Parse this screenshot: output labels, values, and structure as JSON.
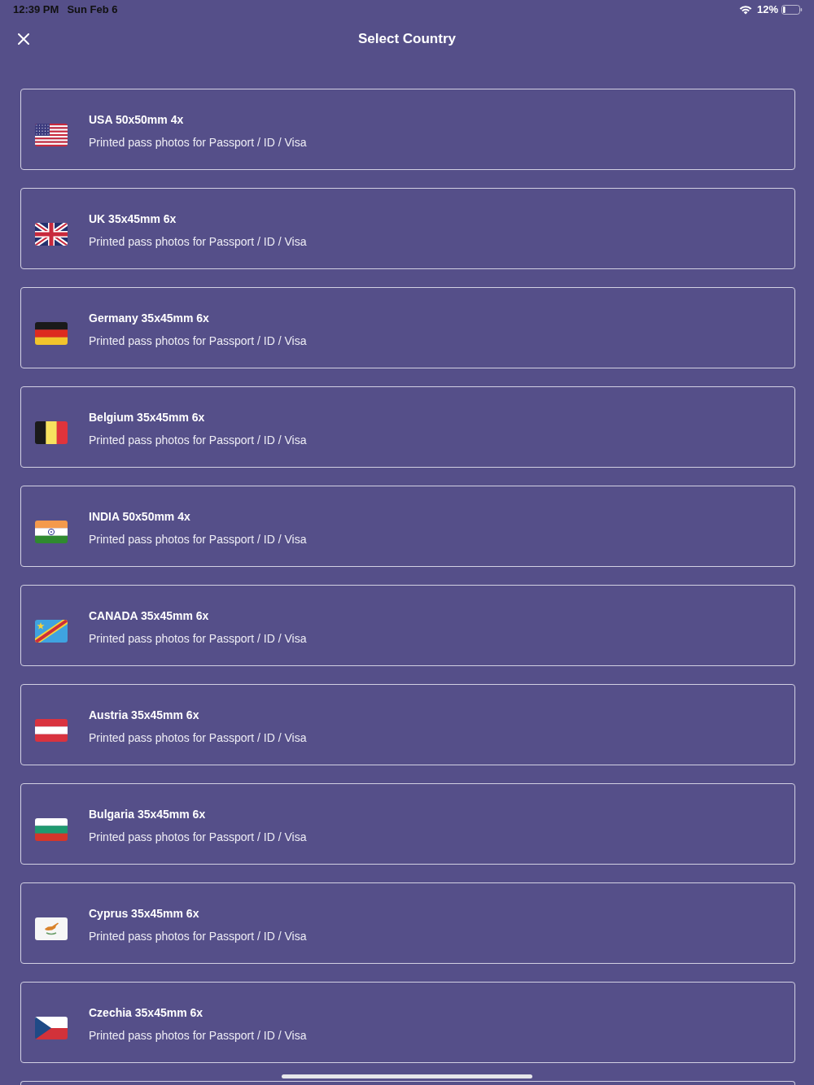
{
  "status_bar": {
    "time": "12:39 PM",
    "date": "Sun Feb 6",
    "battery": "12%"
  },
  "header": {
    "title": "Select Country"
  },
  "countries": [
    {
      "kind": "usa",
      "title": "USA 50x50mm 4x",
      "subtitle": "Printed pass photos for Passport / ID / Visa"
    },
    {
      "kind": "uk",
      "title": "UK 35x45mm 6x",
      "subtitle": "Printed pass photos for Passport / ID / Visa"
    },
    {
      "kind": "germany",
      "title": "Germany 35x45mm 6x",
      "subtitle": "Printed pass photos for Passport / ID / Visa"
    },
    {
      "kind": "belgium",
      "title": "Belgium 35x45mm 6x",
      "subtitle": "Printed pass photos for Passport / ID / Visa"
    },
    {
      "kind": "india",
      "title": "INDIA 50x50mm 4x",
      "subtitle": "Printed pass photos for Passport / ID / Visa"
    },
    {
      "kind": "congo",
      "title": "CANADA 35x45mm 6x",
      "subtitle": "Printed pass photos for Passport / ID / Visa"
    },
    {
      "kind": "austria",
      "title": "Austria 35x45mm 6x",
      "subtitle": "Printed pass photos for Passport / ID / Visa"
    },
    {
      "kind": "bulgaria",
      "title": "Bulgaria 35x45mm 6x",
      "subtitle": "Printed pass photos for Passport / ID / Visa"
    },
    {
      "kind": "cyprus",
      "title": "Cyprus 35x45mm 6x",
      "subtitle": "Printed pass photos for Passport / ID / Visa"
    },
    {
      "kind": "czechia",
      "title": "Czechia 35x45mm 6x",
      "subtitle": "Printed pass photos for Passport / ID / Visa"
    }
  ]
}
